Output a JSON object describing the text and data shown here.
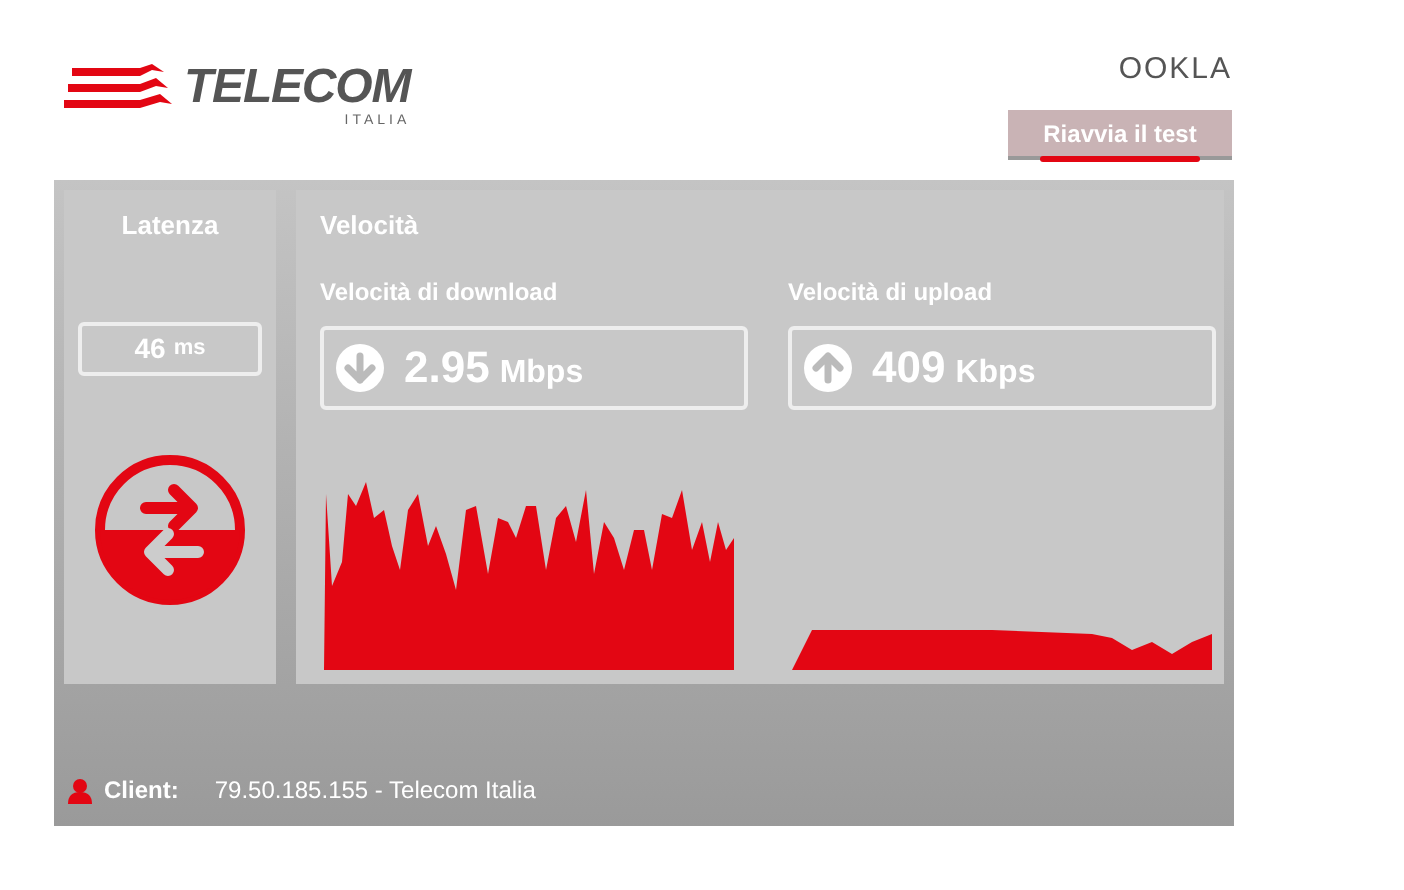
{
  "logo": {
    "name": "TELECOM",
    "sub": "ITALIA"
  },
  "ookla_logo": "OOKLA",
  "restart_button": "Riavvia il test",
  "latency": {
    "title": "Latenza",
    "value": "46",
    "unit": "ms"
  },
  "speed": {
    "title": "Velocità",
    "sections": [
      {
        "kind": "download",
        "label": "Velocità di download",
        "value": "2.95",
        "unit": "Mbps"
      },
      {
        "kind": "upload",
        "label": "Velocità di upload",
        "value": "409",
        "unit": "Kbps"
      }
    ]
  },
  "footer": {
    "label": "Client:",
    "value": "79.50.185.155 - Telecom Italia"
  }
}
